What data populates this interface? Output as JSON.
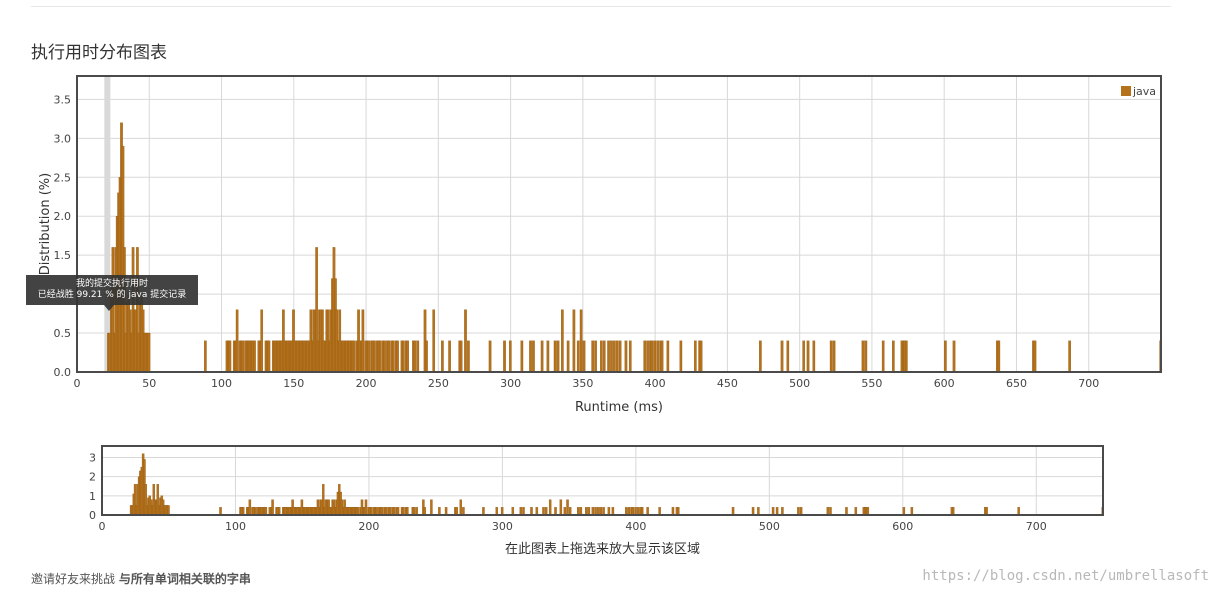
{
  "page": {
    "section_title": "执行用时分布图表",
    "overview_hint": "在此图表上拖选来放大显示该区域",
    "footer": {
      "invite_label": "邀请好友来挑战",
      "related_label": "与所有单词相关联的字串"
    },
    "watermark": "https://blog.csdn.net/umbrellasoft",
    "tooltip": {
      "line1": "我的提交执行用时",
      "line2": "已经战胜 99.21 % 的 java 提交记录"
    }
  },
  "colors": {
    "bar": "#b5721b",
    "bar_stroke": "#8a5512",
    "grid": "#d8d8d8",
    "frame": "#4a4a4a",
    "highlight": "#d9d9d9"
  },
  "chart_data": [
    {
      "type": "bar",
      "xlabel": "Runtime (ms)",
      "ylabel": "Distribution (%)",
      "xlim": [
        0,
        750
      ],
      "ylim": [
        0,
        3.8
      ],
      "x_ticks": [
        "0",
        "50",
        "100",
        "150",
        "200",
        "250",
        "300",
        "350",
        "400",
        "450",
        "500",
        "550",
        "600",
        "650",
        "700"
      ],
      "y_ticks": [
        "0.0",
        "0.5",
        "1.0",
        "1.5",
        "2.0",
        "2.5",
        "3.0",
        "3.5"
      ],
      "grid": true,
      "legend_position": "top-right",
      "highlight_runtime": 21,
      "series": [
        {
          "name": "java",
          "x": [
            21,
            22,
            23,
            24,
            25,
            26,
            27,
            28,
            29,
            30,
            31,
            32,
            33,
            34,
            35,
            36,
            37,
            38,
            39,
            40,
            41,
            42,
            43,
            44,
            45,
            46,
            47,
            48,
            49,
            88,
            103,
            104,
            105,
            108,
            109,
            110,
            112,
            113,
            114,
            116,
            117,
            118,
            119,
            120,
            121,
            122,
            125,
            126,
            127,
            130,
            131,
            132,
            135,
            136,
            137,
            138,
            139,
            140,
            141,
            142,
            143,
            144,
            145,
            146,
            147,
            148,
            149,
            150,
            151,
            152,
            153,
            154,
            155,
            156,
            157,
            158,
            159,
            160,
            161,
            162,
            163,
            164,
            165,
            166,
            167,
            168,
            169,
            170,
            171,
            172,
            173,
            174,
            175,
            176,
            177,
            178,
            179,
            180,
            181,
            182,
            183,
            184,
            185,
            186,
            187,
            188,
            189,
            190,
            191,
            193,
            194,
            195,
            196,
            197,
            199,
            200,
            201,
            203,
            204,
            205,
            207,
            208,
            209,
            211,
            212,
            214,
            215,
            217,
            218,
            220,
            221,
            224,
            225,
            227,
            228,
            232,
            233,
            235,
            240,
            241,
            246,
            252,
            257,
            264,
            265,
            268,
            270,
            285,
            295,
            299,
            307,
            313,
            315,
            321,
            325,
            330,
            332,
            335,
            339,
            343,
            346,
            348,
            350,
            356,
            358,
            362,
            364,
            367,
            369,
            371,
            373,
            375,
            379,
            382,
            392,
            394,
            396,
            397,
            399,
            401,
            403,
            404,
            408,
            417,
            427,
            430,
            431,
            472,
            487,
            491,
            502,
            505,
            509,
            521,
            523,
            543,
            545,
            557,
            564,
            570,
            571,
            572,
            573,
            600,
            606,
            636,
            637,
            661,
            662,
            686,
            749
          ],
          "y": [
            0.5,
            0.5,
            1.1,
            1.6,
            0.5,
            1.6,
            2.0,
            2.3,
            2.5,
            3.2,
            2.9,
            1.6,
            0.5,
            0.9,
            1.0,
            0.8,
            0.5,
            1.6,
            0.8,
            0.8,
            1.6,
            0.5,
            0.9,
            1.0,
            0.8,
            0.5,
            0.5,
            0.5,
            0.5,
            0.4,
            0.4,
            0.4,
            0.4,
            0.4,
            0.4,
            0.8,
            0.4,
            0.4,
            0.4,
            0.4,
            0.4,
            0.4,
            0.4,
            0.4,
            0.4,
            0.4,
            0.4,
            0.4,
            0.8,
            0.4,
            0.4,
            0.4,
            0.4,
            0.4,
            0.4,
            0.4,
            0.4,
            0.4,
            0.4,
            0.8,
            0.4,
            0.4,
            0.4,
            0.4,
            0.4,
            0.4,
            0.8,
            0.4,
            0.4,
            0.4,
            0.4,
            0.4,
            0.4,
            0.4,
            0.4,
            0.4,
            0.4,
            0.4,
            0.8,
            0.4,
            0.8,
            0.8,
            1.6,
            0.4,
            0.8,
            0.8,
            0.8,
            0.4,
            0.4,
            0.8,
            0.8,
            0.4,
            0.8,
            1.2,
            1.6,
            1.2,
            0.8,
            0.4,
            0.8,
            0.4,
            0.4,
            0.4,
            0.4,
            0.4,
            0.4,
            0.4,
            0.4,
            0.4,
            0.4,
            0.4,
            0.8,
            0.4,
            0.4,
            0.8,
            0.4,
            0.4,
            0.4,
            0.4,
            0.4,
            0.4,
            0.4,
            0.4,
            0.4,
            0.4,
            0.4,
            0.4,
            0.4,
            0.4,
            0.4,
            0.4,
            0.4,
            0.4,
            0.4,
            0.4,
            0.4,
            0.4,
            0.4,
            0.4,
            0.8,
            0.4,
            0.8,
            0.4,
            0.4,
            0.4,
            0.4,
            0.8,
            0.4,
            0.4,
            0.4,
            0.4,
            0.4,
            0.4,
            0.4,
            0.4,
            0.4,
            0.4,
            0.4,
            0.8,
            0.4,
            0.8,
            0.4,
            0.8,
            0.4,
            0.4,
            0.4,
            0.4,
            0.4,
            0.4,
            0.4,
            0.4,
            0.4,
            0.4,
            0.4,
            0.4,
            0.4,
            0.4,
            0.4,
            0.4,
            0.4,
            0.4,
            0.4,
            0.4,
            0.4,
            0.4,
            0.4,
            0.4,
            0.4,
            0.4,
            0.4,
            0.4,
            0.4,
            0.4,
            0.4,
            0.4,
            0.4,
            0.4,
            0.4,
            0.4,
            0.4,
            0.4,
            0.4,
            0.4,
            0.4,
            0.4,
            0.4,
            0.4,
            0.4,
            0.4,
            0.4,
            0.4,
            0.4
          ]
        }
      ]
    },
    {
      "type": "bar",
      "xlabel": "在此图表上拖选来放大显示该区域",
      "ylabel": "",
      "xlim": [
        0,
        750
      ],
      "ylim": [
        0,
        3.6
      ],
      "x_ticks": [
        "0",
        "100",
        "200",
        "300",
        "400",
        "500",
        "600",
        "700"
      ],
      "y_ticks": [
        "0",
        "1",
        "2",
        "3"
      ],
      "grid": true,
      "series_ref": "java"
    }
  ]
}
